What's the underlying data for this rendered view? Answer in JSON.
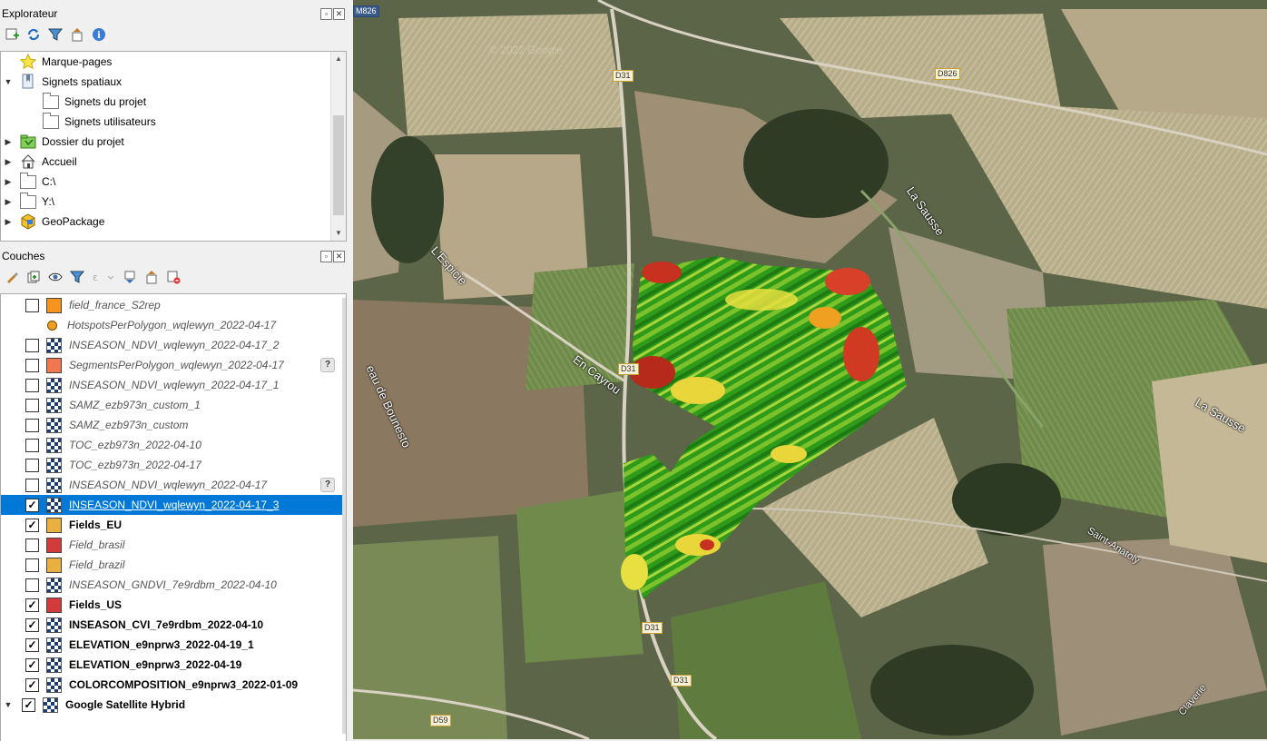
{
  "explorer": {
    "title": "Explorateur",
    "items": [
      {
        "label": "Marque-pages",
        "icon": "star-icon",
        "indent": 0,
        "arrow": ""
      },
      {
        "label": "Signets spatiaux",
        "icon": "bookmark-icon",
        "indent": 0,
        "arrow": "▼"
      },
      {
        "label": "Signets du projet",
        "icon": "folder-icon",
        "indent": 1,
        "arrow": ""
      },
      {
        "label": "Signets utilisateurs",
        "icon": "folder-icon",
        "indent": 1,
        "arrow": ""
      },
      {
        "label": "Dossier du projet",
        "icon": "project-folder-icon",
        "indent": 0,
        "arrow": "▶"
      },
      {
        "label": "Accueil",
        "icon": "home-icon",
        "indent": 0,
        "arrow": "▶"
      },
      {
        "label": "C:\\",
        "icon": "folder-icon",
        "indent": 0,
        "arrow": "▶"
      },
      {
        "label": "Y:\\",
        "icon": "folder-icon",
        "indent": 0,
        "arrow": "▶"
      },
      {
        "label": "GeoPackage",
        "icon": "geopackage-icon",
        "indent": 0,
        "arrow": "▶"
      }
    ]
  },
  "layers_panel": {
    "title": "Couches",
    "layers": [
      {
        "name": "field_france_S2rep",
        "checked": false,
        "style": "off",
        "symbol": "fill",
        "color": "#f7941d",
        "help": false
      },
      {
        "name": "HotspotsPerPolygon_wqlewyn_2022-04-17",
        "checked": null,
        "style": "off",
        "symbol": "dot",
        "color": "#f0a020",
        "help": false
      },
      {
        "name": "INSEASON_NDVI_wqlewyn_2022-04-17_2",
        "checked": false,
        "style": "off",
        "symbol": "raster",
        "color": "",
        "help": false
      },
      {
        "name": "SegmentsPerPolygon_wqlewyn_2022-04-17",
        "checked": false,
        "style": "off",
        "symbol": "fill",
        "color": "#f07850",
        "help": true
      },
      {
        "name": "INSEASON_NDVI_wqlewyn_2022-04-17_1",
        "checked": false,
        "style": "off",
        "symbol": "raster",
        "color": "",
        "help": false
      },
      {
        "name": "SAMZ_ezb973n_custom_1",
        "checked": false,
        "style": "off",
        "symbol": "raster",
        "color": "",
        "help": false
      },
      {
        "name": "SAMZ_ezb973n_custom",
        "checked": false,
        "style": "off",
        "symbol": "raster",
        "color": "",
        "help": false
      },
      {
        "name": "TOC_ezb973n_2022-04-10",
        "checked": false,
        "style": "off",
        "symbol": "raster",
        "color": "",
        "help": false
      },
      {
        "name": "TOC_ezb973n_2022-04-17",
        "checked": false,
        "style": "off",
        "symbol": "raster",
        "color": "",
        "help": false
      },
      {
        "name": "INSEASON_NDVI_wqlewyn_2022-04-17",
        "checked": false,
        "style": "off",
        "symbol": "raster",
        "color": "",
        "help": true
      },
      {
        "name": "INSEASON_NDVI_wqlewyn_2022-04-17_3",
        "checked": true,
        "style": "sel",
        "symbol": "raster",
        "color": "",
        "help": false
      },
      {
        "name": "Fields_EU",
        "checked": true,
        "style": "on",
        "symbol": "fill",
        "color": "#e8b040",
        "help": false
      },
      {
        "name": "Field_brasil",
        "checked": false,
        "style": "off",
        "symbol": "fill",
        "color": "#d33a3a",
        "help": false
      },
      {
        "name": "Field_brazil",
        "checked": false,
        "style": "off",
        "symbol": "fill",
        "color": "#e8b040",
        "help": false
      },
      {
        "name": "INSEASON_GNDVI_7e9rdbm_2022-04-10",
        "checked": false,
        "style": "off",
        "symbol": "raster",
        "color": "",
        "help": false
      },
      {
        "name": "Fields_US",
        "checked": true,
        "style": "on",
        "symbol": "fill",
        "color": "#d33a3a",
        "help": false
      },
      {
        "name": "INSEASON_CVI_7e9rdbm_2022-04-10",
        "checked": true,
        "style": "on",
        "symbol": "raster",
        "color": "",
        "help": false
      },
      {
        "name": "ELEVATION_e9nprw3_2022-04-19_1",
        "checked": true,
        "style": "on",
        "symbol": "raster",
        "color": "",
        "help": false
      },
      {
        "name": "ELEVATION_e9nprw3_2022-04-19",
        "checked": true,
        "style": "on",
        "symbol": "raster",
        "color": "",
        "help": false
      },
      {
        "name": "COLORCOMPOSITION_e9nprw3_2022-01-09",
        "checked": true,
        "style": "on",
        "symbol": "raster",
        "color": "",
        "help": false
      },
      {
        "name": "Google Satellite Hybrid",
        "checked": true,
        "style": "on",
        "symbol": "raster",
        "color": "",
        "help": false,
        "expanded": true
      }
    ]
  },
  "map": {
    "road_labels": [
      "M826",
      "D31",
      "D826",
      "D31",
      "D31",
      "D31",
      "D59"
    ],
    "place_labels": [
      "La Sausse",
      "La Sausse",
      "L'Espicie",
      "En Cayrou",
      "eau de Bounesto",
      "Saint-Anatoly",
      "Claverie"
    ],
    "watermark": "© 2022 Google"
  }
}
